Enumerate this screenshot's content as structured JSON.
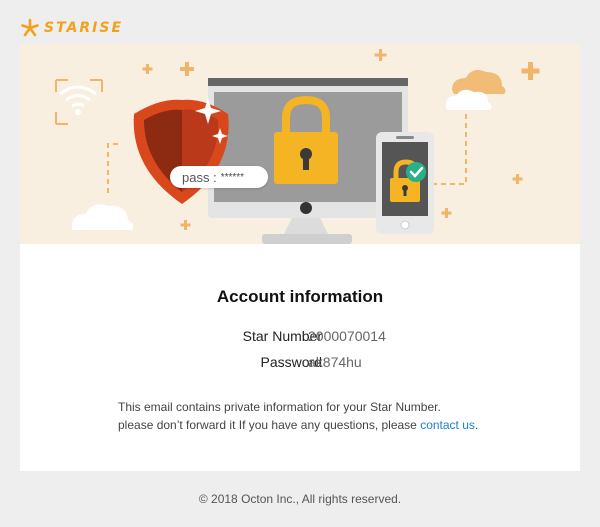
{
  "brand": {
    "name": "STARISE",
    "color": "#f5a01a"
  },
  "hero": {
    "pass_label": "pass :",
    "pass_mask": "******",
    "illustration_icons": [
      "wifi-icon",
      "shield-icon",
      "monitor-icon",
      "padlock-icon",
      "phone-icon",
      "check-icon",
      "cloud-icon",
      "sparkle-icon"
    ]
  },
  "content": {
    "title": "Account information",
    "fields": [
      {
        "label": "Star Number",
        "value": "2000070014"
      },
      {
        "label": "Password",
        "value": "ak874hu"
      }
    ],
    "notice_line1": "This email contains private information for your Star Number.",
    "notice_line2": "please don’t forward it If you have any questions, please ",
    "contact_link": "contact us",
    "notice_end": "."
  },
  "footer": {
    "copyright": "© 2018 Octon Inc., All rights reserved."
  },
  "colors": {
    "background": "#eeeeee",
    "hero": "#f8efe0",
    "link": "#1a7fd6",
    "accent": "#f5a01a",
    "shield": "#d9471c",
    "padlock": "#f4b423"
  }
}
